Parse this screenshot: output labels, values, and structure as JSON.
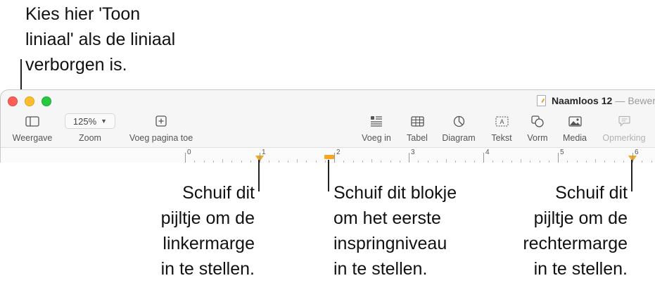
{
  "callouts": {
    "top": [
      "Kies hier 'Toon",
      "liniaal' als de liniaal",
      "verborgen is."
    ],
    "left_margin": [
      "Schuif dit",
      "pijltje om de",
      "linkermarge",
      "in te stellen."
    ],
    "first_indent": [
      "Schuif dit blokje",
      "om het eerste",
      "inspringniveau",
      "in te stellen."
    ],
    "right_margin": [
      "Schuif dit",
      "pijltje om de",
      "rechtermarge",
      "in te stellen."
    ]
  },
  "window": {
    "doc_name": "Naamloos 12",
    "separator": "—",
    "app_suffix": "Bewer"
  },
  "toolbar": {
    "view": "Weergave",
    "zoom": "Zoom",
    "zoom_value": "125%",
    "add_page": "Voeg pagina toe",
    "insert": "Voeg in",
    "table": "Tabel",
    "chart": "Diagram",
    "text": "Tekst",
    "shape": "Vorm",
    "media": "Media",
    "comment": "Opmerking"
  },
  "ruler": {
    "numbers": [
      "0",
      "1",
      "2",
      "3",
      "4",
      "5",
      "6"
    ],
    "marker_color": "#f5a623"
  },
  "icons": {
    "view": "sidebar-icon",
    "add_page": "plus-square-icon",
    "insert": "list-icon",
    "table": "table-icon",
    "chart": "pie-chart-icon",
    "text": "text-box-icon",
    "shape": "shape-icon",
    "media": "image-icon",
    "comment": "comment-icon"
  }
}
